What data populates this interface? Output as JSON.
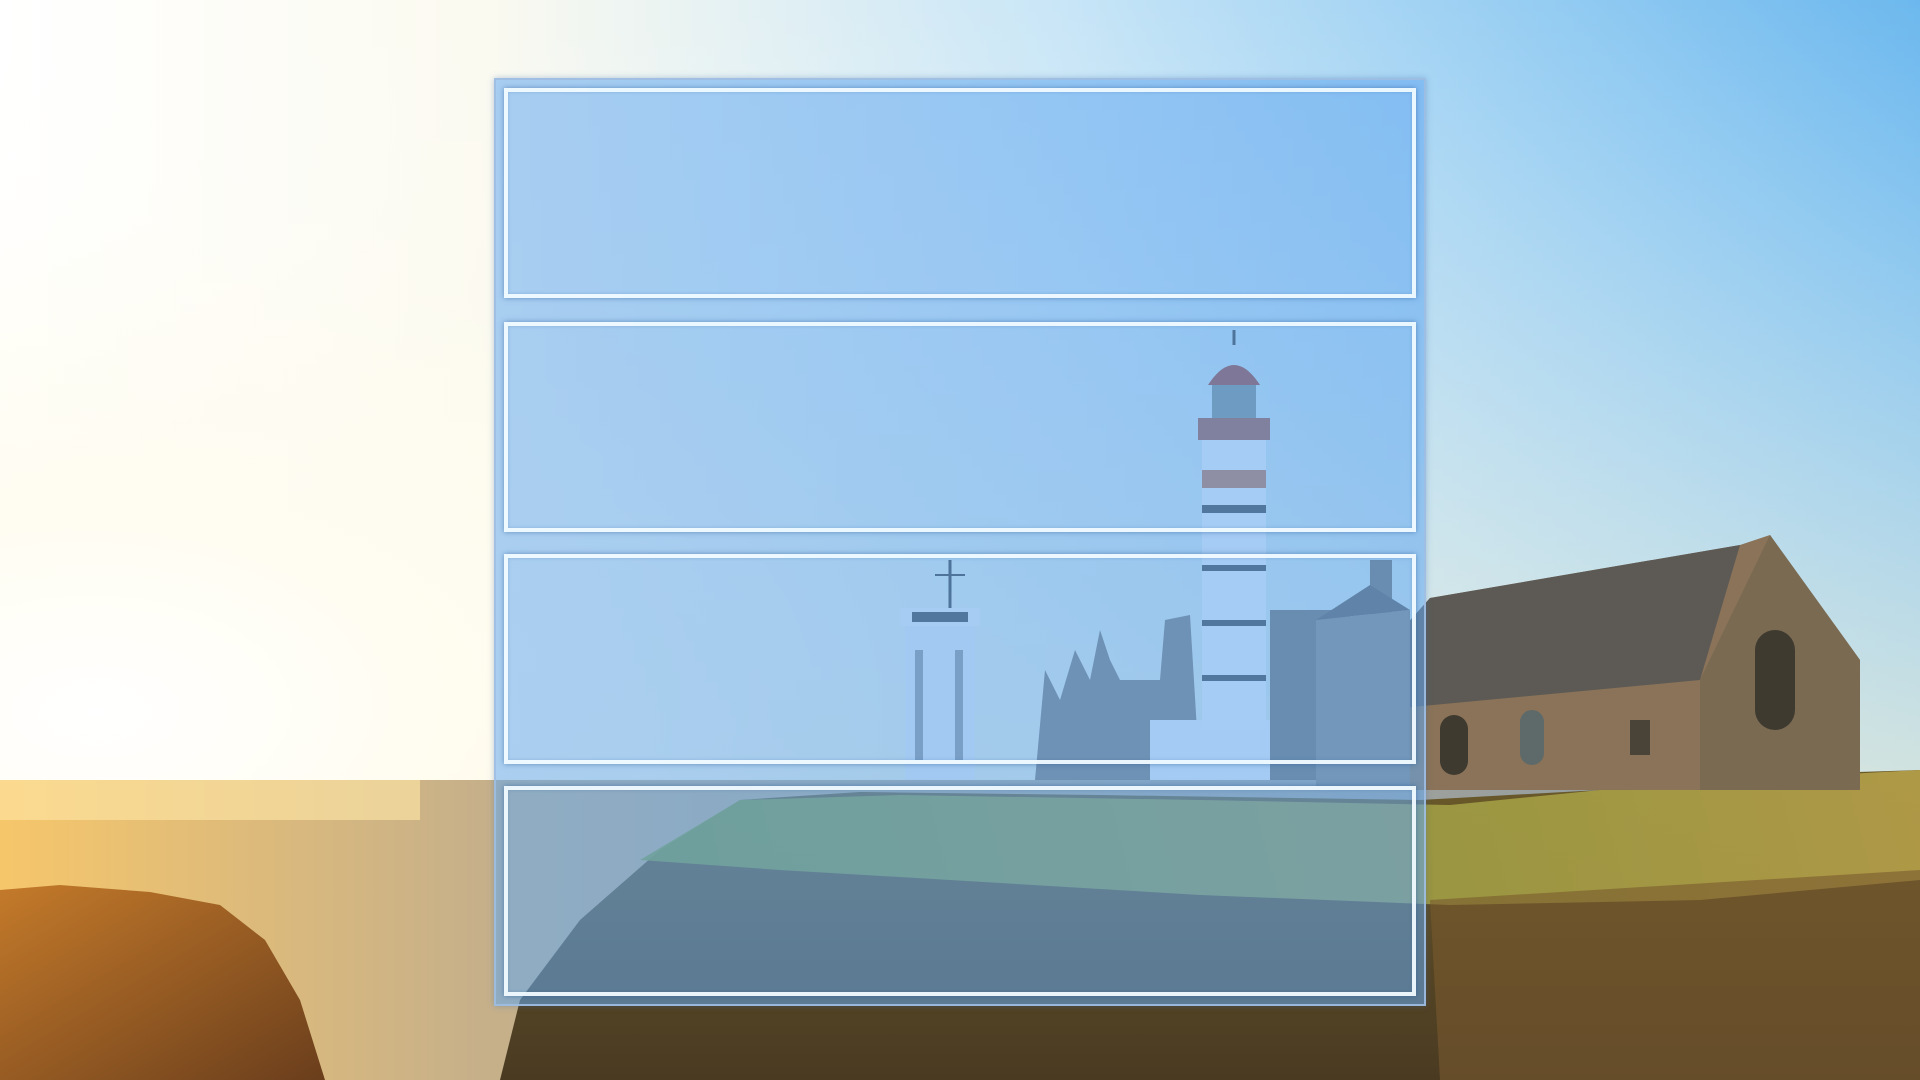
{
  "desktop": {
    "wallpaper": {
      "subject": "",
      "sky_top": "#7ec3f2",
      "sky_horizon": "#fdfbf2",
      "sun_glow": "#ffffff",
      "sea": "#9aa6ad",
      "cliff": "#8a5a2a",
      "grass": "#6f8a2c",
      "lighthouse_white": "#f4f6f8",
      "lighthouse_red": "#b8623f",
      "stone": "#7d6a55",
      "roof": "#5a5752"
    }
  },
  "snap_layout": {
    "overlay_color": "#64aaf0",
    "zone_border_color": "#f0faff",
    "zones": [
      {
        "id": "zone-1",
        "label": ""
      },
      {
        "id": "zone-2",
        "label": ""
      },
      {
        "id": "zone-3",
        "label": ""
      },
      {
        "id": "zone-4",
        "label": ""
      }
    ]
  }
}
